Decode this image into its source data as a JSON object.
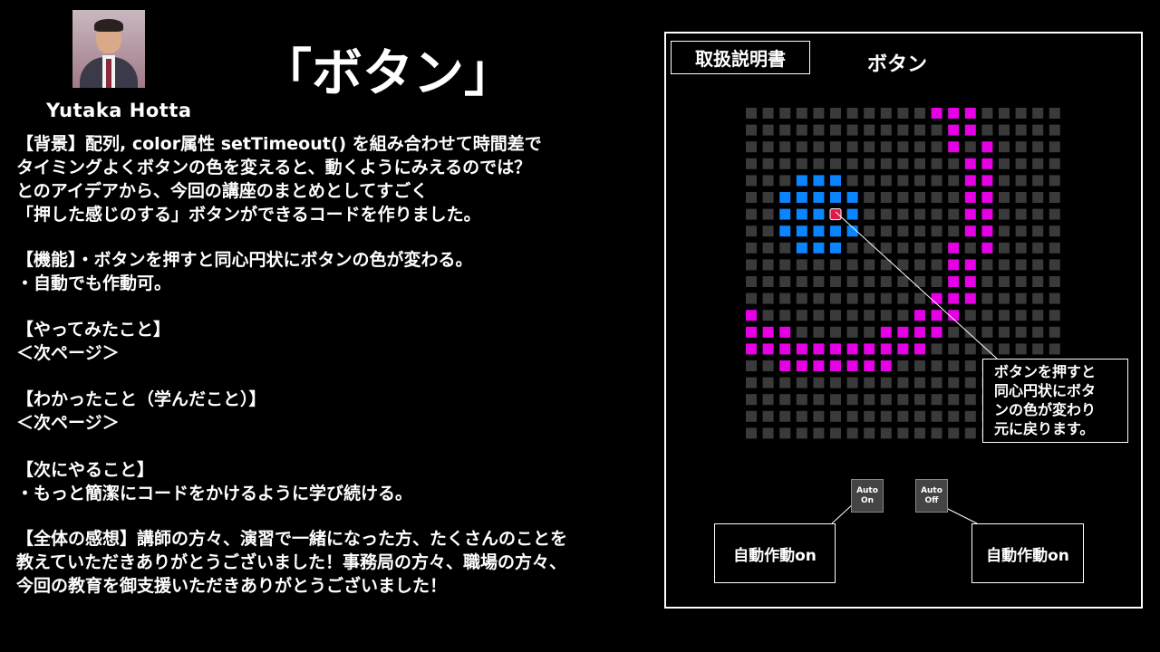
{
  "author": {
    "name": "Yutaka Hotta"
  },
  "title": "「ボタン」",
  "description": {
    "lines": [
      "【背景】配列, color属性 setTimeout() を組み合わせて時間差で",
      "  タイミングよくボタンの色を変えると、動くようにみえるのでは？",
      "  とのアイデアから、今回の講座のまとめとしてすごく",
      "  「押した感じのする」ボタンができるコードを作りました。",
      "【機能】・ボタンを押すと同心円状にボタンの色が変わる。",
      "          ・自動でも作動可。",
      "【やってみたこと】",
      "  ＜次ページ＞",
      "【わかったこと（学んだこと）】",
      "  ＜次ページ＞",
      "【次にやること】",
      "・もっと簡潔にコードをかけるように学び続ける。",
      "【全体の感想】講師の方々、演習で一緒になった方、たくさんのことを",
      "教えていただきありがとうございました！事務局の方々、職場の方々、",
      "今回の教育を御支援いただきありがとうございました！"
    ]
  },
  "panel": {
    "manual_label": "取扱説明書",
    "title": "ボタン",
    "grid": {
      "cols": 19,
      "rows": 20,
      "colors": {
        "off": "#3a3a3a",
        "blue": "#0a84ff",
        "magenta": "#e600e6",
        "pressed": "#e01848"
      },
      "pressed_cell": [
        5,
        6
      ],
      "blue_cells": [
        [
          3,
          4
        ],
        [
          4,
          4
        ],
        [
          5,
          4
        ],
        [
          2,
          5
        ],
        [
          3,
          5
        ],
        [
          4,
          5
        ],
        [
          5,
          5
        ],
        [
          6,
          5
        ],
        [
          2,
          6
        ],
        [
          3,
          6
        ],
        [
          4,
          6
        ],
        [
          6,
          6
        ],
        [
          2,
          7
        ],
        [
          3,
          7
        ],
        [
          4,
          7
        ],
        [
          5,
          7
        ],
        [
          6,
          7
        ],
        [
          3,
          8
        ],
        [
          4,
          8
        ],
        [
          5,
          8
        ]
      ],
      "magenta_cells": [
        [
          11,
          0
        ],
        [
          12,
          0
        ],
        [
          13,
          0
        ],
        [
          12,
          1
        ],
        [
          13,
          1
        ],
        [
          12,
          2
        ],
        [
          14,
          2
        ],
        [
          13,
          3
        ],
        [
          14,
          3
        ],
        [
          13,
          4
        ],
        [
          14,
          4
        ],
        [
          13,
          5
        ],
        [
          14,
          5
        ],
        [
          13,
          6
        ],
        [
          14,
          6
        ],
        [
          13,
          7
        ],
        [
          14,
          7
        ],
        [
          12,
          8
        ],
        [
          14,
          8
        ],
        [
          12,
          9
        ],
        [
          13,
          9
        ],
        [
          12,
          10
        ],
        [
          13,
          10
        ],
        [
          11,
          11
        ],
        [
          12,
          11
        ],
        [
          13,
          11
        ],
        [
          0,
          12
        ],
        [
          10,
          12
        ],
        [
          11,
          12
        ],
        [
          12,
          12
        ],
        [
          0,
          13
        ],
        [
          1,
          13
        ],
        [
          2,
          13
        ],
        [
          8,
          13
        ],
        [
          9,
          13
        ],
        [
          10,
          13
        ],
        [
          11,
          13
        ],
        [
          0,
          14
        ],
        [
          1,
          14
        ],
        [
          2,
          14
        ],
        [
          3,
          14
        ],
        [
          4,
          14
        ],
        [
          5,
          14
        ],
        [
          6,
          14
        ],
        [
          7,
          14
        ],
        [
          8,
          14
        ],
        [
          9,
          14
        ],
        [
          10,
          14
        ],
        [
          2,
          15
        ],
        [
          3,
          15
        ],
        [
          4,
          15
        ],
        [
          5,
          15
        ],
        [
          6,
          15
        ],
        [
          7,
          15
        ],
        [
          8,
          15
        ]
      ]
    },
    "callout": {
      "lines": [
        "ボタンを押すと",
        "同心円状にボタ",
        "ンの色が変わり",
        "元に戻ります。"
      ]
    },
    "auto_on": {
      "line1": "Auto",
      "line2": "On"
    },
    "auto_off": {
      "line1": "Auto",
      "line2": "Off"
    },
    "note_left": "自動作動on",
    "note_right": "自動作動on"
  }
}
